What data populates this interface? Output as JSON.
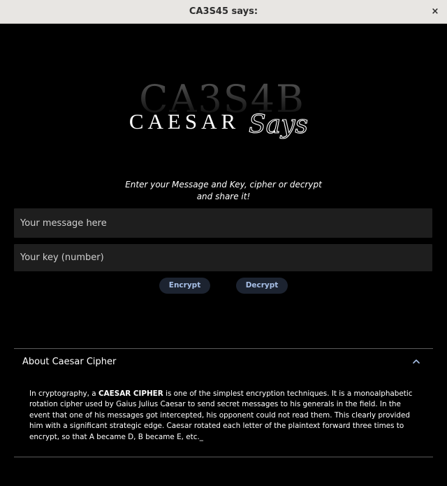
{
  "window": {
    "title": "CA3S45 says:",
    "close_glyph": "×"
  },
  "logo": {
    "background_text": "CA3S4B",
    "main_text": "CAESAR",
    "script_text": "Says"
  },
  "instructions": {
    "line1": "Enter your Message and Key, cipher or decrypt",
    "line2": "and share it!"
  },
  "form": {
    "message_placeholder": "Your message here",
    "message_value": "",
    "key_placeholder": "Your key (number)",
    "key_value": "",
    "encrypt_label": "Encrypt",
    "decrypt_label": "Decrypt"
  },
  "about": {
    "title": "About Caesar Cipher",
    "expanded": true,
    "chevron_icon": "chevron-up-icon",
    "text_before": "In cryptography, a ",
    "text_bold": "CAESAR CIPHER",
    "text_after": " is one of the simplest encryption techniques. It is a monoalphabetic rotation cipher used by Gaius Julius Caesar to send secret messages to his generals in the field. In the event that one of his messages got intercepted, his opponent could not read them. This clearly provided him with a significant strategic edge. Caesar rotated each letter of the plaintext forward three times to encrypt, so that A became D, B became E, etc._"
  },
  "colors": {
    "background": "#000000",
    "titlebar": "#e8e6e3",
    "field": "#1e1e1e",
    "button": "#1c2330",
    "button_text": "#a7bfe6",
    "divider": "#5a5a5a"
  }
}
